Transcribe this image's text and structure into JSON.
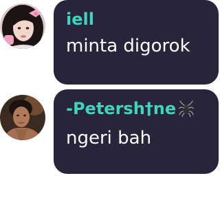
{
  "messages": [
    {
      "sender": "iell",
      "text": "minta digorok",
      "avatar": "girl-portrait-with-pink-bow"
    },
    {
      "sender": "-Petersh†ne",
      "text": "ngeri bah",
      "avatar": "man-portrait-dark",
      "badge_icon": "spider-icon"
    }
  ],
  "colors": {
    "bubble": "#28243a",
    "sender_name": "#3fd4c0",
    "message_text": "#ffffff",
    "background": "#ffffff"
  }
}
